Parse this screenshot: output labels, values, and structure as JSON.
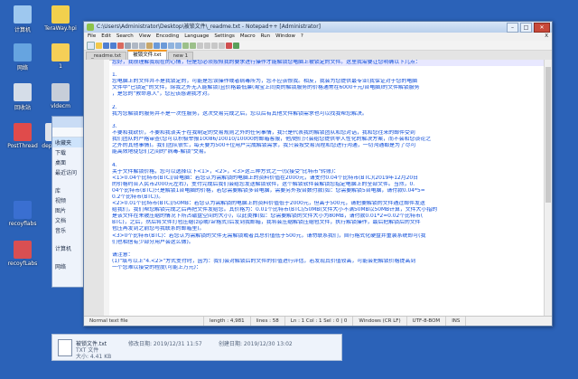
{
  "desktop": {
    "icons": [
      {
        "label": "计算机",
        "color": "#9ec8ef"
      },
      {
        "label": "TeraWay.hpi",
        "color": "#f2d04d"
      },
      {
        "label": "网络",
        "color": "#66a4e0"
      },
      {
        "label": "1",
        "color": "#f5cf57"
      },
      {
        "label": "回收站",
        "color": "#d5dde8"
      },
      {
        "label": "vldecm",
        "color": "#c7ced9"
      },
      {
        "label": "PostThread",
        "color": "#e04b4b"
      },
      {
        "label": "depx.exe",
        "color": "#dfe3ea"
      },
      {
        "label": "recoyflabs",
        "color": "#3a6fd1"
      },
      {
        "label": "recoyfLabs",
        "color": "#d94f52"
      }
    ]
  },
  "explorer": {
    "tree": [
      "收藏夹",
      "下载",
      "桌面",
      "最近访问",
      "",
      "库",
      "视频",
      "图片",
      "文档",
      "音乐",
      "",
      "计算机",
      "",
      "网络"
    ]
  },
  "notepad": {
    "title": "C:\\Users\\Administrator\\Desktop\\被锁文件\\_readme.txt - Notepad++ [Administrator]",
    "menu": [
      "File",
      "Edit",
      "Search",
      "View",
      "Encoding",
      "Language",
      "Settings",
      "Macro",
      "Run",
      "Window",
      "?"
    ],
    "menu_close": "X",
    "tabs": [
      "_readme.txt",
      "被锁文件.txt",
      "new 1"
    ],
    "lines": [
      {
        "n": "1",
        "t": "您好，我很理解我现在的心情，但是您必须按照我的要求进行操作才能解锁您电脑上被锁定的文件。这里我需要让您明确以下几点："
      },
      {
        "n": "2",
        "t": ""
      },
      {
        "n": "3",
        "t": "1."
      },
      {
        "n": "4",
        "t": "您电脑上的文件并不是我锁定的，可能是您误操作或者病毒所为，您不应该恨我。相反，我会为您提供最专业(我保证对于您的电脑"
      },
      {
        "n": "5",
        "t": "文件中\"已锁定\"的文件，除我之外无人能解锁)且价格最低廉(淘宝上同类的解锁服务的价格通常在6000+元/台电脑)的文件解锁服务"
      },
      {
        "n": "6",
        "t": "，是您的\"救命恩人\"，您应该感谢我才对。"
      },
      {
        "n": "7",
        "t": ""
      },
      {
        "n": "8",
        "t": "2."
      },
      {
        "n": "9",
        "t": "我为您解锁的服务并不是一次性服务，这次交易完成之后，您以后有其他文件解锁需求也可以找我帮您解决。"
      },
      {
        "n": "10",
        "t": ""
      },
      {
        "n": "11",
        "t": "3."
      },
      {
        "n": "12",
        "t": "不要和我砍价，不要和我谈关于在我制定的交易规则之外的任何事情，我只是代表我的解锁团队和您对话，我和您往来的邮件受到"
      },
      {
        "n": "13",
        "t": "我们团队的严格审查(您可以积极举报10086/10010/10000的邮箱客服，他/她们只会给您提供非人性化的解决方案，而不会和您谈论之"
      },
      {
        "n": "14",
        "t": "之外的其他事情)。我们团队很忙，每天要为500+位用户完成解锁需求，我只会按交易流程和您进行沟通，一切沟通都是为了尽可"
      },
      {
        "n": "15",
        "t": "能高效地使您们之间的\"病毒-解锁\"交易。"
      },
      {
        "n": "16",
        "t": ""
      },
      {
        "n": "17",
        "t": "4."
      },
      {
        "n": "18",
        "t": "关于文件解锁价格，您可以选择以下<1>，<2>，<3>这三种方式之一(仅接受\"比特币\"转账)："
      },
      {
        "n": "19",
        "t": "<1>0.04个比特币(BTC)/台电脑：若您认为需解锁的电脑上的资料价值在2000元，请支付0.04个比特币(BTC)(2019年12月20日"
      },
      {
        "n": "20",
        "t": "的价格约合人民币2000元左右)，支付完成后我们会给您发送解锁软件，这个解锁软件会解锁您指定电脑上的全部文件。当然，0."
      },
      {
        "n": "21",
        "t": "04个比特币(BTC)只是解锁1台电脑的价格，若您需要解锁多台电脑，需要另外按台数付款(如：您需要解锁5台电脑，请付款0.04*5="
      },
      {
        "n": "22",
        "t": "0.2个比特币(BTC))。"
      },
      {
        "n": "23",
        "t": "<2>0.01个比特币(BTC)/50MB：若您认为需解锁的电脑上的资料价值低于2000元，但高于500元，请把要解锁的文件通过邮件发送"
      },
      {
        "n": "24",
        "t": "给我们，我们帮您解锁完成之后再把文件发给您。其价格为：0.01个比特币(BTC)/50MB(文件大小不满50MB以50MB计算，文件大小指的"
      },
      {
        "n": "25",
        "t": "是该文件在未被压缩的情况下所占磁盘空间的大小)，以此类推(如：您需要解锁的文件大小为80MB，请付款0.01*2=0.02个比特币("
      },
      {
        "n": "26",
        "t": "BTC)，之后，然后将文件打包压缩(zip或rar格式)后发到我邮箱，我将会压缩解锁压缩包文件，执行解锁操作，最后把解锁后的文件"
      },
      {
        "n": "27",
        "t": "包压再发到之前您与我联系的邮箱里)。"
      },
      {
        "n": "28",
        "t": "<3>0个比特币(BTC)：若您认为需解锁的文件无需解锁或者其总价值低于500元，请勿联系我们，自行格式化硬盘并重装系统即可(我"
      },
      {
        "n": "29",
        "t": "们也相信有少部分用户会这么做)。"
      },
      {
        "n": "30",
        "t": ""
      },
      {
        "n": "31",
        "t": "请注意："
      },
      {
        "n": "32",
        "t": "(1)\"填写以上\"4.<2>\"方式支付时，因为：我们会对解锁后的文件的价值进行评估，若发现其价值较高，可能会把解锁价格提高到"
      },
      {
        "n": "33",
        "t": "一个您难以接受的程度(可能上万元)："
      }
    ],
    "status": {
      "type": "Normal text file",
      "length": "length : 4,981",
      "lines": "lines : 58",
      "position": "Ln : 1   Col : 1   Sel : 0 | 0",
      "eol": "Windows (CR LF)",
      "encoding": "UTF-8-BOM",
      "mode": "INS"
    }
  },
  "details": {
    "name": "被锁文件.txt",
    "type": "TXT 文件",
    "size": "大小: 4.41 KB",
    "modified": "修改日期: 2019/12/31 11:57",
    "created": "创建日期: 2019/12/30 13:02"
  }
}
